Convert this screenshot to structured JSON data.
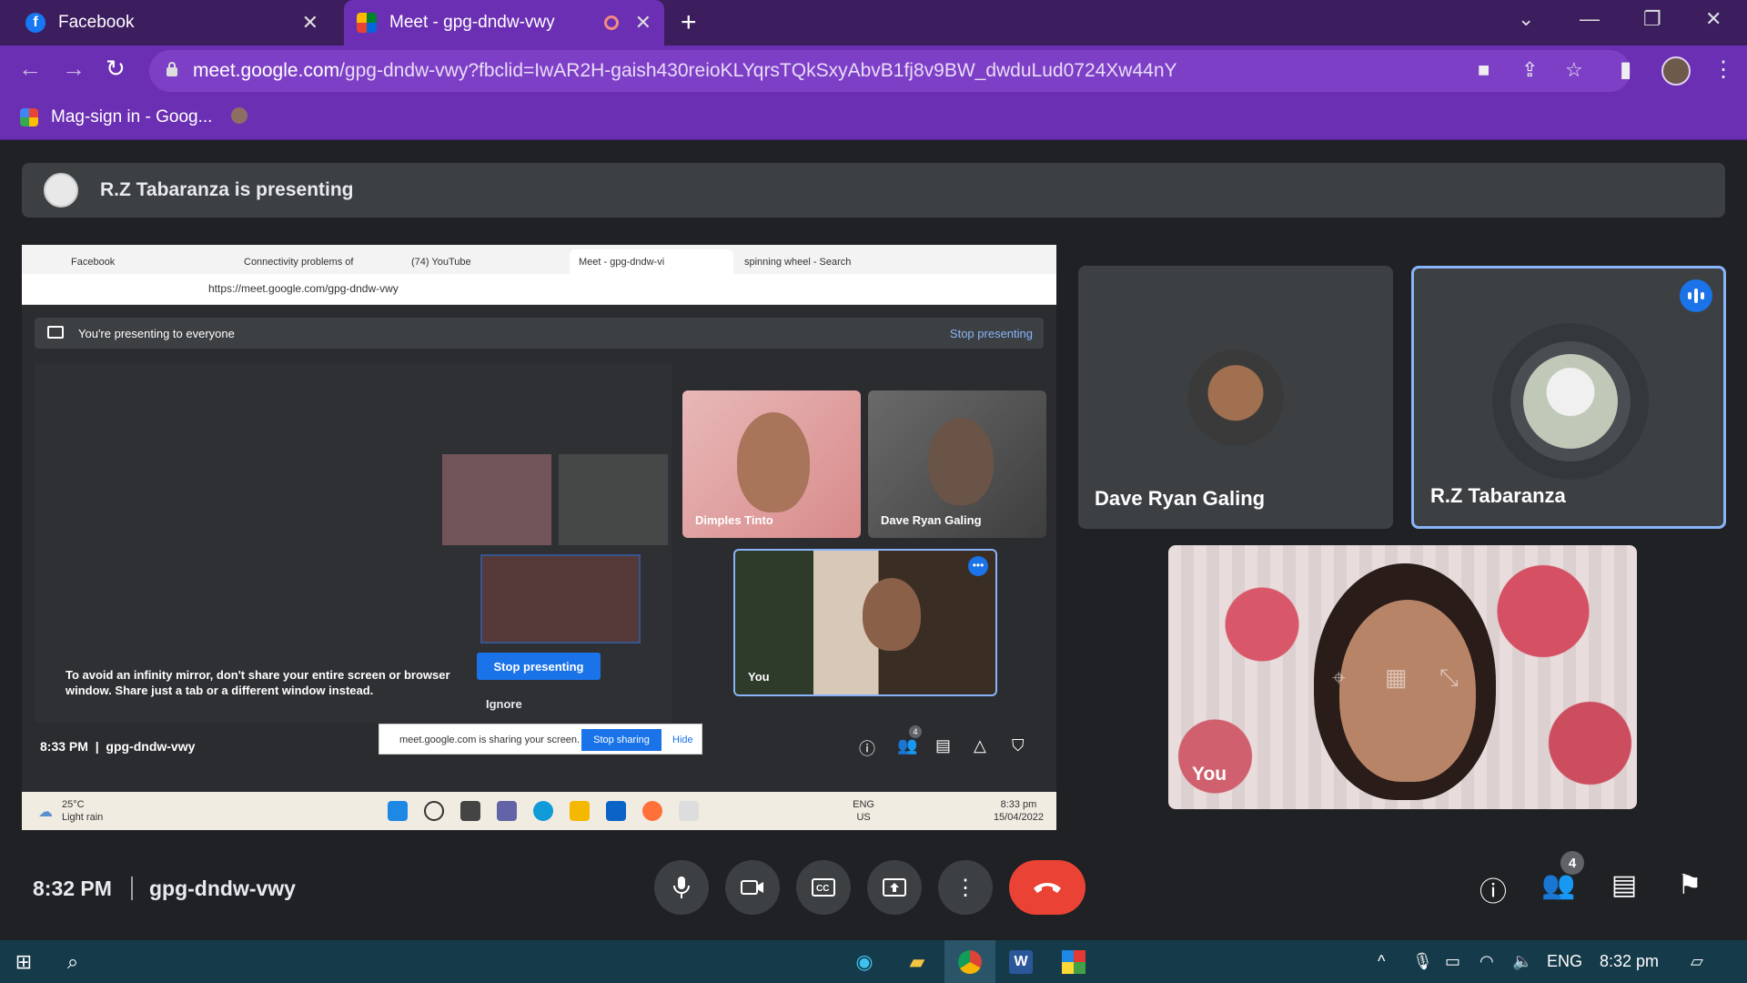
{
  "browser": {
    "tabs": [
      {
        "title": "Facebook",
        "favicon": "facebook-icon"
      },
      {
        "title": "Meet - gpg-dndw-vwy",
        "favicon": "meet-icon"
      }
    ],
    "url_host": "meet.google.com",
    "url_rest": "/gpg-dndw-vwy?fbclid=IwAR2H-gaish430reioKLYqrsTQkSxyAbvB1fj8v9BW_dwduLud0724Xw44nY",
    "bookmark": "Mag-sign in - Goog..."
  },
  "meet": {
    "banner_text": "R.Z Tabaranza is presenting",
    "time": "8:32 PM",
    "code": "gpg-dndw-vwy",
    "participant_count": "4",
    "participants": [
      {
        "name": "Dave Ryan Galing"
      },
      {
        "name": "R.Z Tabaranza"
      },
      {
        "name": "You"
      }
    ]
  },
  "shared_screen": {
    "tabs": [
      "Facebook",
      "Connectivity problems of",
      "(74) YouTube",
      "Meet - gpg-dndw-vi",
      "spinning wheel - Search"
    ],
    "url": "https://meet.google.com/gpg-dndw-vwy",
    "presenting_text": "You're presenting to everyone",
    "stop_presenting_link": "Stop presenting",
    "infinity_message": "To avoid an infinity mirror, don't share your entire screen or browser window. Share just a tab or a different window instead.",
    "stop_presenting_button": "Stop presenting",
    "ignore": "Ignore",
    "tiles": [
      {
        "name": "Dimples Tinto"
      },
      {
        "name": "Dave Ryan Galing"
      },
      {
        "name": "You"
      }
    ],
    "sharing_bar_text": "meet.google.com is sharing your screen.",
    "stop_sharing": "Stop sharing",
    "hide": "Hide",
    "time": "8:33 PM",
    "code": "gpg-dndw-vwy",
    "participant_count": "4",
    "weather_temp": "25°C",
    "weather_desc": "Light rain",
    "tray_lang": "ENG",
    "tray_region": "US",
    "tray_time": "8:33 pm",
    "tray_date": "15/04/2022"
  },
  "taskbar": {
    "lang": "ENG",
    "time": "8:32 pm"
  },
  "colors": {
    "tab_strip": "#3c1e5f",
    "toolbar": "#6b2fb3",
    "meet_bg": "#202124",
    "end_call": "#ea4335",
    "accent": "#1a73e8"
  }
}
